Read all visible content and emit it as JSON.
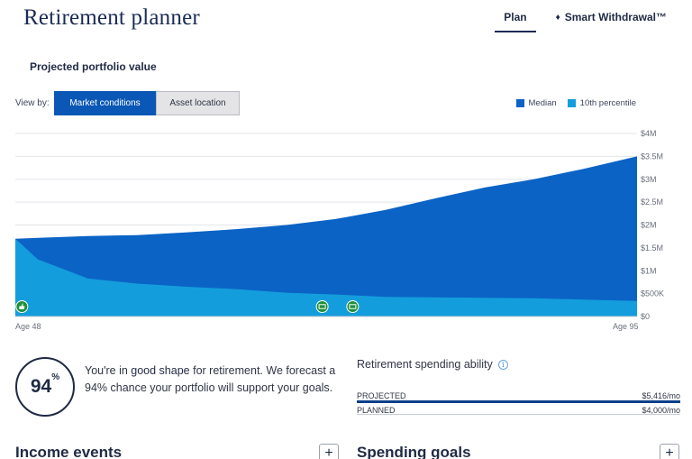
{
  "app": {
    "title": "Retirement planner"
  },
  "nav": {
    "tabs": [
      {
        "label": "Plan",
        "active": true
      },
      {
        "label": "Smart Withdrawal™",
        "icon": "diamond-badge-icon"
      }
    ]
  },
  "chart_section": {
    "title": "Projected portfolio value",
    "view_by_label": "View by:",
    "toggle": {
      "options": [
        "Market conditions",
        "Asset location"
      ],
      "selected": "Market conditions"
    }
  },
  "chart_data": {
    "type": "area",
    "x_start_label": "Age 48",
    "x_end_label": "Age 95",
    "x": [
      48,
      49.7,
      53.5,
      57.2,
      61,
      64.7,
      68.5,
      72.2,
      76,
      79.7,
      83.5,
      87.2,
      91,
      95
    ],
    "y_ticks": [
      "$0",
      "$500K",
      "$1M",
      "$1.5M",
      "$2M",
      "$2.5M",
      "$3M",
      "$3.5M",
      "$4M"
    ],
    "ylim": [
      0,
      4000000
    ],
    "grid": true,
    "legend_position": "top-right",
    "series": [
      {
        "name": "Median",
        "color": "#0b63c5",
        "values": [
          1700000,
          1720000,
          1760000,
          1780000,
          1840000,
          1910000,
          2000000,
          2130000,
          2330000,
          2580000,
          2820000,
          3000000,
          3230000,
          3500000
        ]
      },
      {
        "name": "10th percentile",
        "color": "#149ddc",
        "values": [
          1700000,
          1250000,
          830000,
          720000,
          650000,
          600000,
          520000,
          480000,
          430000,
          420000,
          410000,
          400000,
          370000,
          340000
        ]
      }
    ],
    "markers": [
      {
        "x": 48.5,
        "icon": "thumbs-up-icon"
      },
      {
        "x": 71.2,
        "icon": "cash-icon"
      },
      {
        "x": 73.5,
        "icon": "cash-icon"
      }
    ]
  },
  "summary": {
    "score": "94",
    "score_unit": "%",
    "text_pre": "You're in ",
    "text_em": "good shape",
    "text_post": " for retirement. We forecast a 94% chance your portfolio will support your goals."
  },
  "spending": {
    "title": "Retirement spending ability",
    "projected_label": "PROJECTED",
    "projected_value": "$5,416/mo",
    "planned_label": "PLANNED",
    "planned_value": "$4,000/mo"
  },
  "sections": {
    "income_events": "Income events",
    "spending_goals": "Spending goals",
    "add_symbol": "+"
  }
}
